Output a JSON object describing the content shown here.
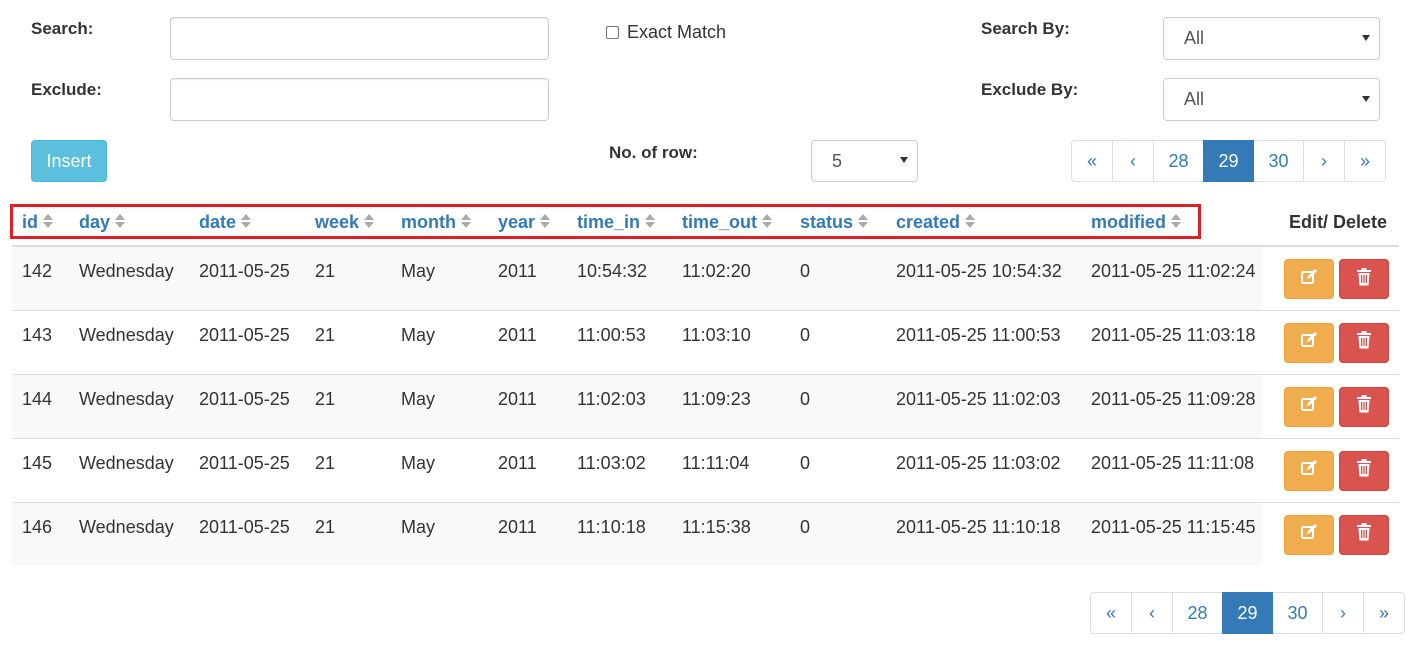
{
  "filters": {
    "search_label": "Search:",
    "search_value": "",
    "exact_match_label": "Exact Match",
    "search_by_label": "Search By:",
    "search_by_value": "All",
    "exclude_label": "Exclude:",
    "exclude_value": "",
    "exclude_by_label": "Exclude By:",
    "exclude_by_value": "All",
    "insert_label": "Insert",
    "rows_label": "No. of row:",
    "rows_value": "5"
  },
  "pagination": {
    "first": "«",
    "prev": "‹",
    "pages": [
      "28",
      "29",
      "30"
    ],
    "active": "29",
    "next": "›",
    "last": "»"
  },
  "table": {
    "columns": [
      "id",
      "day",
      "date",
      "week",
      "month",
      "year",
      "time_in",
      "time_out",
      "status",
      "created",
      "modified"
    ],
    "actions_header": "Edit/ Delete",
    "rows": [
      [
        "142",
        "Wednesday",
        "2011-05-25",
        "21",
        "May",
        "2011",
        "10:54:32",
        "11:02:20",
        "0",
        "2011-05-25 10:54:32",
        "2011-05-25 11:02:24"
      ],
      [
        "143",
        "Wednesday",
        "2011-05-25",
        "21",
        "May",
        "2011",
        "11:00:53",
        "11:03:10",
        "0",
        "2011-05-25 11:00:53",
        "2011-05-25 11:03:18"
      ],
      [
        "144",
        "Wednesday",
        "2011-05-25",
        "21",
        "May",
        "2011",
        "11:02:03",
        "11:09:23",
        "0",
        "2011-05-25 11:02:03",
        "2011-05-25 11:09:28"
      ],
      [
        "145",
        "Wednesday",
        "2011-05-25",
        "21",
        "May",
        "2011",
        "11:03:02",
        "11:11:04",
        "0",
        "2011-05-25 11:03:02",
        "2011-05-25 11:11:08"
      ],
      [
        "146",
        "Wednesday",
        "2011-05-25",
        "21",
        "May",
        "2011",
        "11:10:18",
        "11:15:38",
        "0",
        "2011-05-25 11:10:18",
        "2011-05-25 11:15:45"
      ]
    ]
  },
  "colors": {
    "link": "#337ab7",
    "info": "#5bc0de",
    "warning": "#f0ad4e",
    "danger": "#d9534f",
    "highlight": "#e31e24"
  },
  "icons": {
    "sort": "sort-icon",
    "edit": "edit-icon",
    "delete": "trash-icon"
  }
}
